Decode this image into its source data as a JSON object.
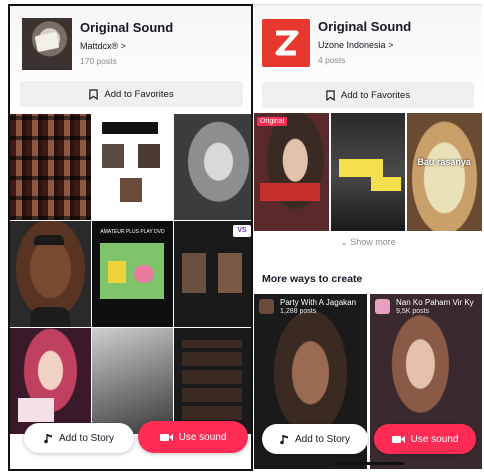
{
  "left": {
    "title": "Original Sound",
    "artist": "Mattdcx®",
    "artist_chevron": ">",
    "posts": "170 posts",
    "favorites_label": "Add to Favorites",
    "grid_texts": {
      "green_caption": "AMATEUR PLUS PLAY DVD"
    },
    "vs_badge": "VS",
    "add_story_label": "Add to Story",
    "use_sound_label": "Use sound"
  },
  "right": {
    "title": "Original Sound",
    "artist": "Uzone Indonesia",
    "artist_chevron": ">",
    "posts": "4 posts",
    "favorites_label": "Add to Favorites",
    "carousel_badge": "Original",
    "card3_caption": "Bau rasanya",
    "show_more": "Show more",
    "section_title": "More ways to create",
    "create_cards": [
      {
        "title": "Party With A Jagakan",
        "posts": "1,288 posts"
      },
      {
        "title": "Nan Ko Paham Vir Ky",
        "posts": "9,5K posts"
      }
    ],
    "add_story_label": "Add to Story",
    "use_sound_label": "Use sound"
  },
  "colors": {
    "accent": "#fe2c55",
    "logo_red": "#e8372e",
    "text": "#161823",
    "muted": "#8a8b91"
  },
  "icons": [
    "bookmark-icon",
    "music-note-icon",
    "video-camera-icon",
    "chevron-down-icon"
  ]
}
